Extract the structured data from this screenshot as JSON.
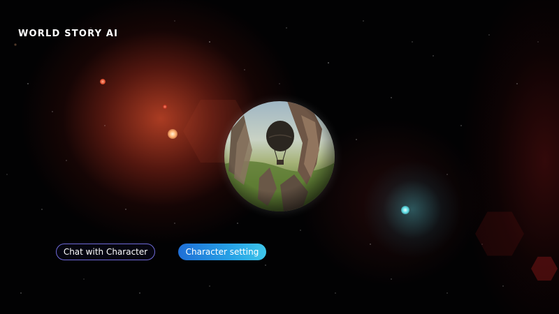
{
  "app": {
    "brand_title": "WORLD STORY AI"
  },
  "buttons": {
    "chat_label": "Chat with Character",
    "setting_label": "Character setting"
  },
  "colors": {
    "background": "#020203",
    "nebula_red": "#c8462a",
    "nebula_teal": "#3c96a0",
    "chat_button_border": "#6f6ad8",
    "setting_button_gradient_start": "#1f6fd6",
    "setting_button_gradient_end": "#3ec6ea"
  },
  "icons": {
    "globe": "world-globe-icon"
  }
}
